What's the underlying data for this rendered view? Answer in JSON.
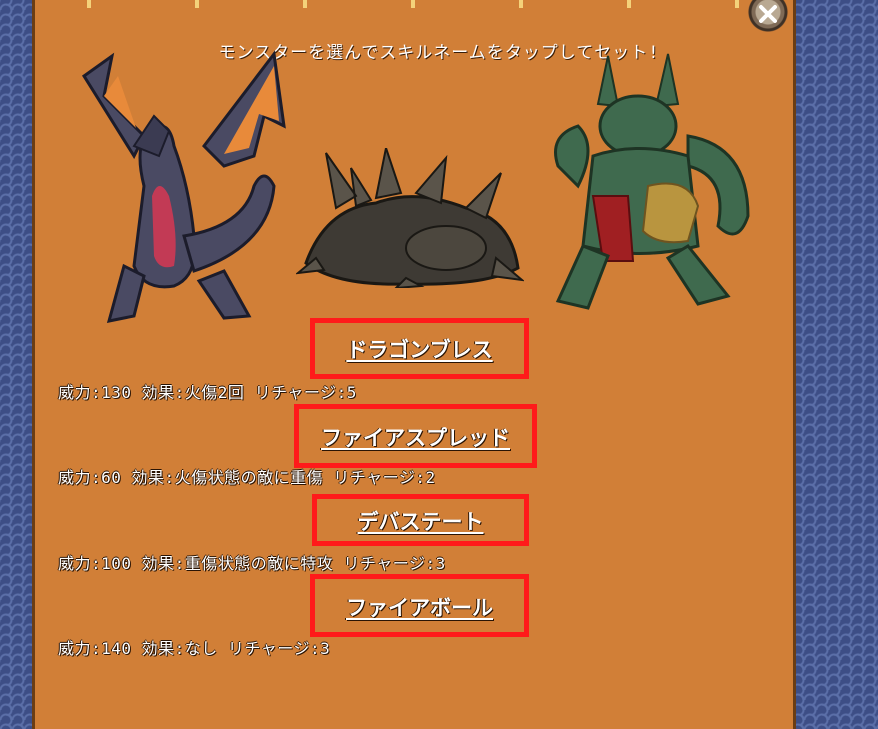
{
  "header": {
    "instruction": "モンスターを選んでスキルネームをタップしてセット!"
  },
  "close_button": {
    "icon": "close-icon"
  },
  "monsters": [
    {
      "name": "dark-winged-dragon",
      "colors": {
        "body": "#4a4a63",
        "wing": "#e88a3a",
        "belly": "#c23a55"
      }
    },
    {
      "name": "spiked-rock-dragon",
      "colors": {
        "body": "#3e3a34",
        "spike": "#6a6456"
      }
    },
    {
      "name": "green-dragon-warrior",
      "colors": {
        "body": "#3f6a4e",
        "cloth": "#a01f22",
        "gold": "#b9953f"
      }
    }
  ],
  "skills": [
    {
      "name": "ドラゴンブレス",
      "description": "威力:130 効果:火傷2回 リチャージ:5",
      "highlighted": true
    },
    {
      "name": "ファイアスプレッド",
      "description": "威力:60 効果:火傷状態の敵に重傷 リチャージ:2",
      "highlighted": true
    },
    {
      "name": "デバステート",
      "description": "威力:100 効果:重傷状態の敵に特攻 リチャージ:3",
      "highlighted": true
    },
    {
      "name": "ファイアボール",
      "description": "威力:140 効果:なし リチャージ:3",
      "highlighted": true
    }
  ],
  "colors": {
    "panel": "#d17f37",
    "highlight": "#ff1a1a",
    "background": "#3d4e86"
  }
}
